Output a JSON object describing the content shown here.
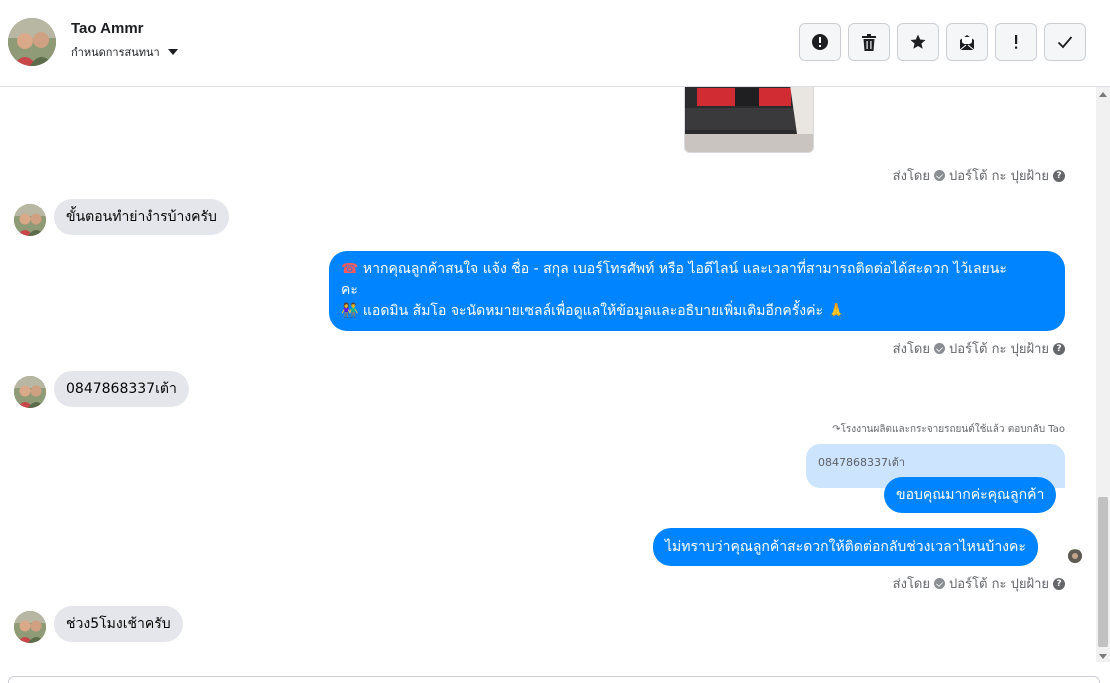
{
  "header": {
    "contact_name": "Tao Ammr",
    "assign_label": "กำหนดการสนทนา",
    "toolbar": [
      {
        "name": "report-spam-button",
        "icon": "alert-circle-icon"
      },
      {
        "name": "delete-button",
        "icon": "trash-icon"
      },
      {
        "name": "star-button",
        "icon": "star-icon"
      },
      {
        "name": "mark-unread-button",
        "icon": "envelope-icon"
      },
      {
        "name": "important-button",
        "icon": "exclamation-icon"
      },
      {
        "name": "done-button",
        "icon": "check-icon"
      }
    ]
  },
  "messages": {
    "meta_sent_by": "ส่งโดย",
    "meta_sender": "ปอร์โต้ กะ ปุยฝ้าย",
    "m1_text": "ขั้นตอนทำย่างำรบ้างครับ",
    "m2_line1": "หากคุณลูกค้าสนใจ แจ้ง ชื่อ - สกุล เบอร์โทรศัพท์ หรือ ไอดีไลน์ และเวลาที่สามารถติดต่อได้สะดวก ไว้เลยนะ",
    "m2_line2": "คะ",
    "m2_line3": "แอดมิน ส้มโอ จะนัดหมายเซลล์เพื่อดูแลให้ข้อมูลและอธิบายเพิ่มเติมอีกครั้งค่ะ",
    "m2_icon1": "☎",
    "m2_icon2": "👫",
    "m2_icon3": "🙏",
    "m3_text": "0847868337เต้า",
    "reply_note": "โรงงานผลิตและกระจายรถยนต์ใช้แล้ว ตอบกลับ Tao",
    "quoted_text": "0847868337เต้า",
    "m4_text": "ขอบคุณมากค่ะคุณลูกค้า",
    "m5_text": "ไม่ทราบว่าคุณลูกค้าสะดวกให้ติดต่อกลับช่วงเวลาไหนบ้างคะ",
    "m6_text": "ช่วง5โมงเช้าครับ"
  },
  "colors": {
    "outgoing_bubble": "#0084ff",
    "incoming_bubble": "#e4e6eb",
    "quoted_bubble": "#cce4fd"
  }
}
